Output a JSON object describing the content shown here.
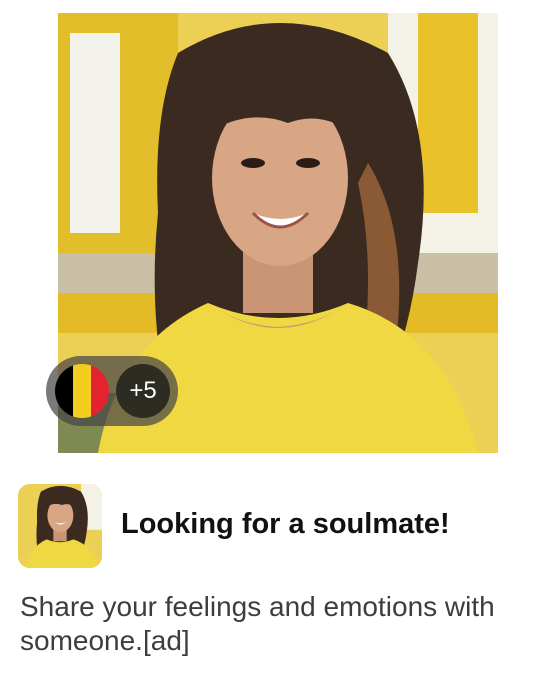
{
  "ad": {
    "title": "Looking for a soulmate!",
    "description": "Share your feelings and emotions with someone.[ad]"
  },
  "image_overlay": {
    "flag_icon": "belgium-flag-icon",
    "flag_colors": [
      "#000000",
      "#f3cd1f",
      "#e3232e"
    ],
    "more_count": "+5"
  },
  "colors": {
    "shirt": "#f0d842",
    "background_sign": "#e9c32c",
    "title_text": "#111111",
    "description_text": "#3d3d3d"
  }
}
